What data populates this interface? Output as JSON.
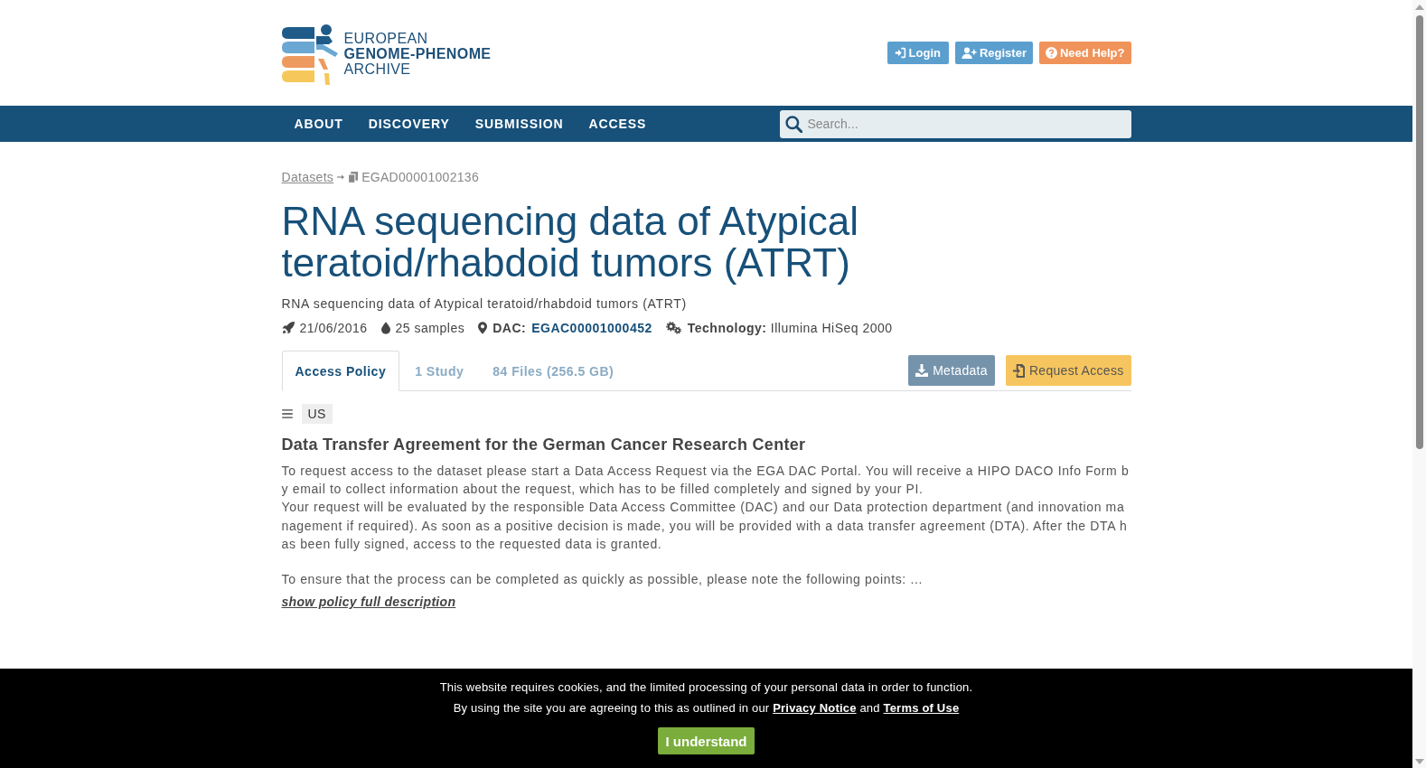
{
  "header": {
    "logo": {
      "lines": [
        {
          "text": "EUROPEAN",
          "bold": false
        },
        {
          "text": "GENOME-PHENOME",
          "bold": true
        },
        {
          "text": "ARCHIVE",
          "bold": false
        }
      ]
    },
    "buttons": [
      {
        "label": "Login",
        "kind": "login"
      },
      {
        "label": "Register",
        "kind": "register"
      },
      {
        "label": "Need Help?",
        "kind": "help"
      }
    ]
  },
  "nav": {
    "items": [
      "ABOUT",
      "DISCOVERY",
      "SUBMISSION",
      "ACCESS"
    ],
    "search": {
      "placeholder": "Search..."
    }
  },
  "breadcrumb": [
    {
      "label": "Datasets",
      "kind": "link"
    },
    {
      "label": "EGAD00001002136",
      "kind": "current"
    }
  ],
  "dataset": {
    "title": "RNA sequencing data of Atypical teratoid/rhabdoid tumors (ATRT)",
    "subtitle": "RNA sequencing data of Atypical teratoid/rhabdoid tumors (ATRT)",
    "meta": [
      {
        "kind": "date",
        "text": "21/06/2016"
      },
      {
        "kind": "samples",
        "text": "25 samples"
      },
      {
        "kind": "dac",
        "label": "DAC:",
        "link": "EGAC00001000452"
      },
      {
        "kind": "technology",
        "text": "**Technology:** Illumina HiSeq 2000"
      }
    ]
  },
  "tabs": [
    {
      "label": "Access Policy",
      "selected": true
    },
    {
      "label": "1 Study",
      "selected": false
    },
    {
      "label": "84 Files (256.5 GB)",
      "selected": false
    }
  ],
  "actions": [
    {
      "label": "Metadata",
      "kind": "metadata"
    },
    {
      "label": "Request Access",
      "kind": "request"
    }
  ],
  "policy": {
    "tag": "US",
    "title": "Data Transfer Agreement for the German Cancer Research Center",
    "paragraphs": [
      "To request access to the dataset please start a Data Access Request via the EGA DAC Portal. You will receive a HIPO DACO Info Form by email to collect information about the request, which has to be filled completely and signed by your PI.\nYour request will be evaluated by the responsible Data Access Committee (DAC) and our Data protection department (and innovation management if required). As soon as a positive decision is made, you will be provided with a data transfer agreement (DTA). After the DTA has been fully signed, access to the requested data is granted.",
      "To ensure that the process can be completed as quickly as possible, please note the following points: ..."
    ],
    "more_link": "show policy full description"
  },
  "cookie_banner": {
    "message": "This website requires cookies, and the limited processing of your personal data in order to function.",
    "consent": [
      {
        "kind": "text",
        "text": "By using the site you are agreeing to this as outlined in our"
      },
      {
        "kind": "link",
        "text": "Privacy Notice"
      },
      {
        "kind": "text",
        "text": "and"
      },
      {
        "kind": "link",
        "text": "Terms of Use"
      }
    ],
    "button": "I understand"
  }
}
